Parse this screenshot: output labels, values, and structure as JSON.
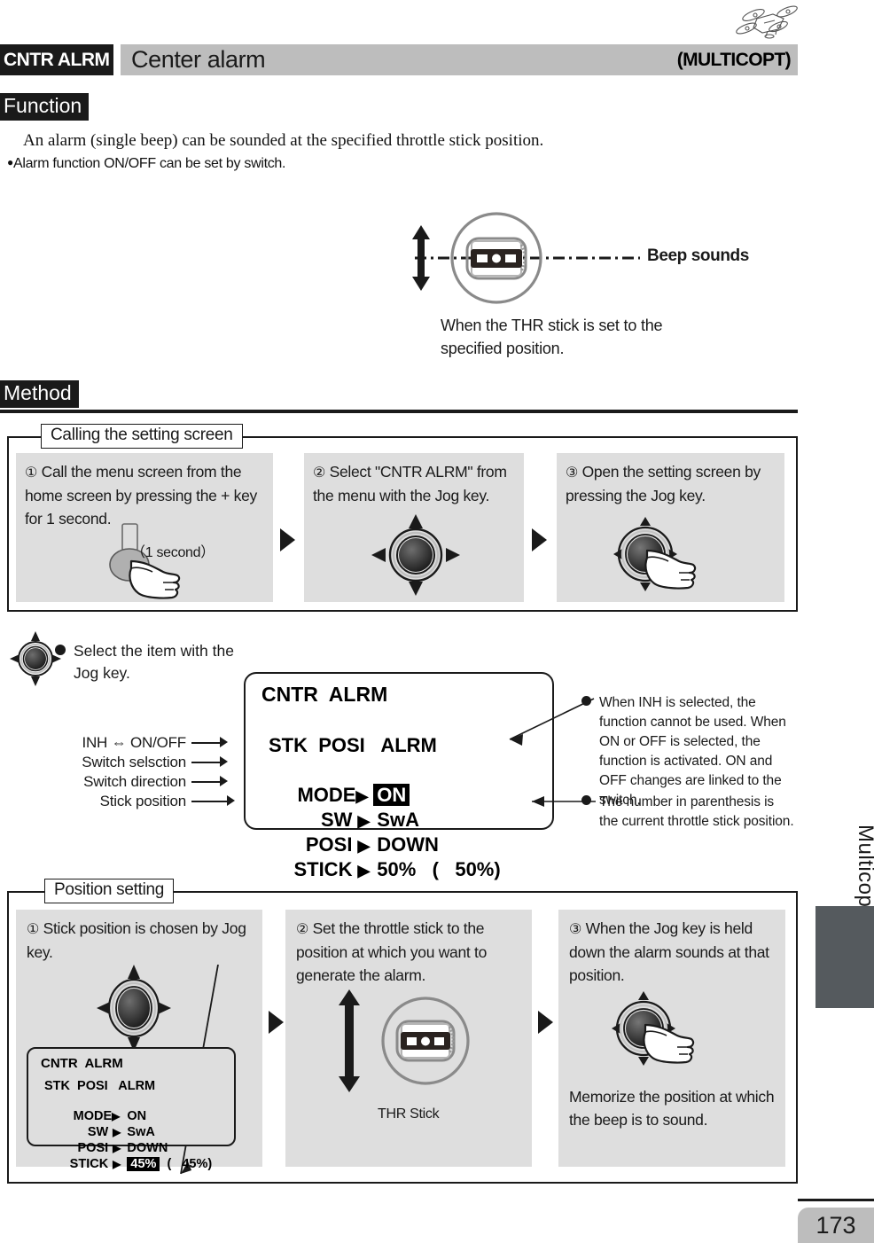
{
  "page": {
    "number": "173",
    "side_label": "Multicopter"
  },
  "header": {
    "code": "CNTR ALRM",
    "title": "Center alarm",
    "model": "(MULTICOPT)",
    "drone_icon": "drone-line-art-icon"
  },
  "function": {
    "tag": "Function",
    "line1": "An alarm (single beep) can be sounded at the specified throttle stick position.",
    "bullet": "●",
    "line2": "Alarm function ON/OFF can be set by switch."
  },
  "beep_illustration": {
    "beep_label": "Beep sounds",
    "caption": "When the THR stick is set to the specified position.",
    "stick_icon": "throttle-stick-top-view-icon",
    "updown_arrow_icon": "up-down-arrow-icon",
    "dashdot_icon": "dash-dot-line-icon"
  },
  "method": {
    "tag": "Method"
  },
  "calling_section": {
    "legend": "Calling the setting screen",
    "steps": [
      {
        "num": "①",
        "text": "Call the menu screen from the home screen by pressing the + key for 1 second.",
        "sub_label": "（1 second）",
        "icon": "plus-key-press-hand-icon"
      },
      {
        "num": "②",
        "text": "Select  \"CNTR ALRM\" from the menu with the Jog key.",
        "icon": "jog-key-fourway-icon"
      },
      {
        "num": "③",
        "text": "Open the setting screen by pressing the Jog key.",
        "icon": "jog-key-press-hand-icon"
      }
    ],
    "next_arrow_icon": "next-step-arrow-icon"
  },
  "jog_note": {
    "bullet": "●",
    "text": "Select the item with the Jog key.",
    "icon": "jog-key-fourway-icon"
  },
  "lcd_main": {
    "title": "CNTR  ALRM",
    "header_row": "STK  POSI   ALRM",
    "rows": [
      {
        "label": "MODE",
        "arrow": "▶",
        "value": "ON",
        "highlight": true
      },
      {
        "label": "SW",
        "arrow": "▶",
        "value": "SwA",
        "highlight": false
      },
      {
        "label": "POSI",
        "arrow": "▶",
        "value": "DOWN",
        "highlight": false
      },
      {
        "label": "STICK",
        "arrow": "▶",
        "value": "50%   (   50%)",
        "highlight": false
      }
    ]
  },
  "left_callouts": [
    "INH ⇔ ON/OFF",
    "Switch selsction",
    "Switch direction",
    "Stick position"
  ],
  "right_notes": [
    {
      "bullet": "●",
      "text": "When INH is selected, the function cannot be used. When ON or OFF is selected, the function is activated. ON and OFF changes are linked to the switch."
    },
    {
      "bullet": "●",
      "text": "The number in parenthesis is the current throttle stick position."
    }
  ],
  "position_section": {
    "legend": "Position setting",
    "steps": [
      {
        "num": "①",
        "text": "Stick position is chosen by Jog key.",
        "icon": "jog-key-fourway-icon"
      },
      {
        "num": "②",
        "text": "Set the throttle stick to the position at which you want to generate the alarm.",
        "icon": "throttle-stick-top-view-icon",
        "caption": "THR Stick"
      },
      {
        "num": "③",
        "text": "When the Jog key is held down the alarm sounds at that position.",
        "icon": "jog-key-press-hand-icon",
        "footer": "Memorize the position at which the beep is to sound."
      }
    ],
    "next_arrow_icon": "next-step-arrow-icon"
  },
  "lcd_small": {
    "title": "CNTR  ALRM",
    "header_row": "STK  POSI   ALRM",
    "rows": [
      {
        "label": "MODE",
        "arrow": "▶",
        "value": "ON",
        "highlight": false
      },
      {
        "label": "SW",
        "arrow": "▶",
        "value": "SwA",
        "highlight": false
      },
      {
        "label": "POSI",
        "arrow": "▶",
        "value": "DOWN",
        "highlight": false
      },
      {
        "label": "STICK",
        "arrow": "▶",
        "value": "45%",
        "suffix": "(   45%)",
        "highlight": true
      }
    ]
  },
  "colors": {
    "black": "#1a1a1a",
    "header_gray": "#bdbdbd",
    "panel_gray": "#dedede",
    "side_tab": "#555a5e"
  }
}
